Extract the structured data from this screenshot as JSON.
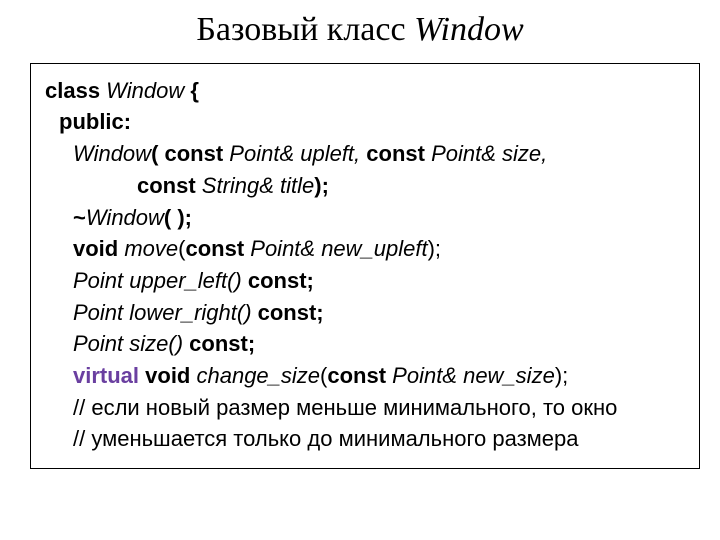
{
  "title": {
    "plain": "Базовый класс ",
    "italic": "Window"
  },
  "code": {
    "l1": {
      "a": "class ",
      "b": "Window",
      "c": " {"
    },
    "l2": "public:",
    "l3": {
      "a": "Window",
      "b": "( const ",
      "c": "Point& upleft,",
      "d": " const ",
      "e": "Point& size,"
    },
    "l4": {
      "a": "const ",
      "b": "String& title",
      "c": ");"
    },
    "l5": {
      "a": "~",
      "b": "Window",
      "c": "( );"
    },
    "l6": {
      "a": "void ",
      "b": "move",
      "c": "(",
      "d": "const ",
      "e": "Point& new_upleft",
      "f": ");"
    },
    "l7": {
      "a": "Point upper_left()",
      "b": " const;"
    },
    "l8": {
      "a": "Point lower_right()",
      "b": " const;"
    },
    "l9": {
      "a": "Point size()",
      "b": " const;"
    },
    "l10": {
      "a": "virtual",
      "b": " void ",
      "c": "change_size",
      "d": "(",
      "e": "const ",
      "f": "Point& new_size",
      "g": ");"
    },
    "c1": "// если новый размер меньше минимального, то окно",
    "c2": "// уменьшается только до минимального размера"
  }
}
